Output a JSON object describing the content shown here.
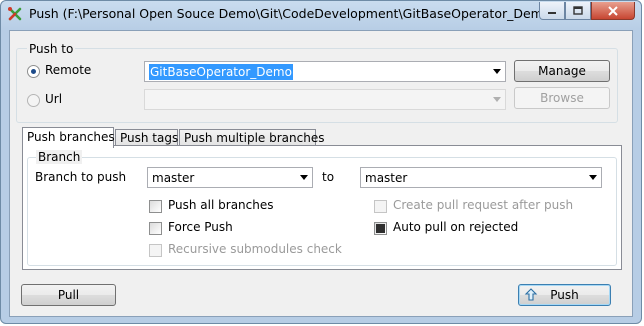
{
  "window": {
    "title": "Push (F:\\Personal Open Souce Demo\\Git\\CodeDevelopment\\GitBaseOperator_Demo\\)",
    "icon": "git-extensions-icon"
  },
  "push_to": {
    "group_label": "Push to",
    "remote_label": "Remote",
    "remote_selected": true,
    "remote_value": "GitBaseOperator_Demo",
    "manage_label": "Manage",
    "url_label": "Url",
    "url_selected": false,
    "url_value": "",
    "browse_label": "Browse"
  },
  "tabs": [
    {
      "label": "Push branches",
      "active": true
    },
    {
      "label": "Push tags",
      "active": false
    },
    {
      "label": "Push multiple branches",
      "active": false
    }
  ],
  "branch": {
    "group_label": "Branch",
    "branch_to_push_label": "Branch to push",
    "local_branch": "master",
    "to_label": "to",
    "remote_branch": "master"
  },
  "options": {
    "push_all_branches": {
      "label": "Push all branches",
      "checked": false,
      "enabled": true
    },
    "force_push": {
      "label": "Force Push",
      "checked": false,
      "enabled": true
    },
    "recursive_submodules": {
      "label": "Recursive submodules check",
      "checked": false,
      "enabled": false
    },
    "create_pull_request": {
      "label": "Create pull request after push",
      "checked": false,
      "enabled": false
    },
    "auto_pull_on_rejected": {
      "label": "Auto pull on rejected",
      "checked": true,
      "enabled": true
    }
  },
  "footer": {
    "pull_label": "Pull",
    "push_label": "Push",
    "push_icon": "push-arrow-icon"
  },
  "colors": {
    "titlebar": "#b7cde5",
    "selection": "#3399ff",
    "close_button": "#c74632"
  }
}
